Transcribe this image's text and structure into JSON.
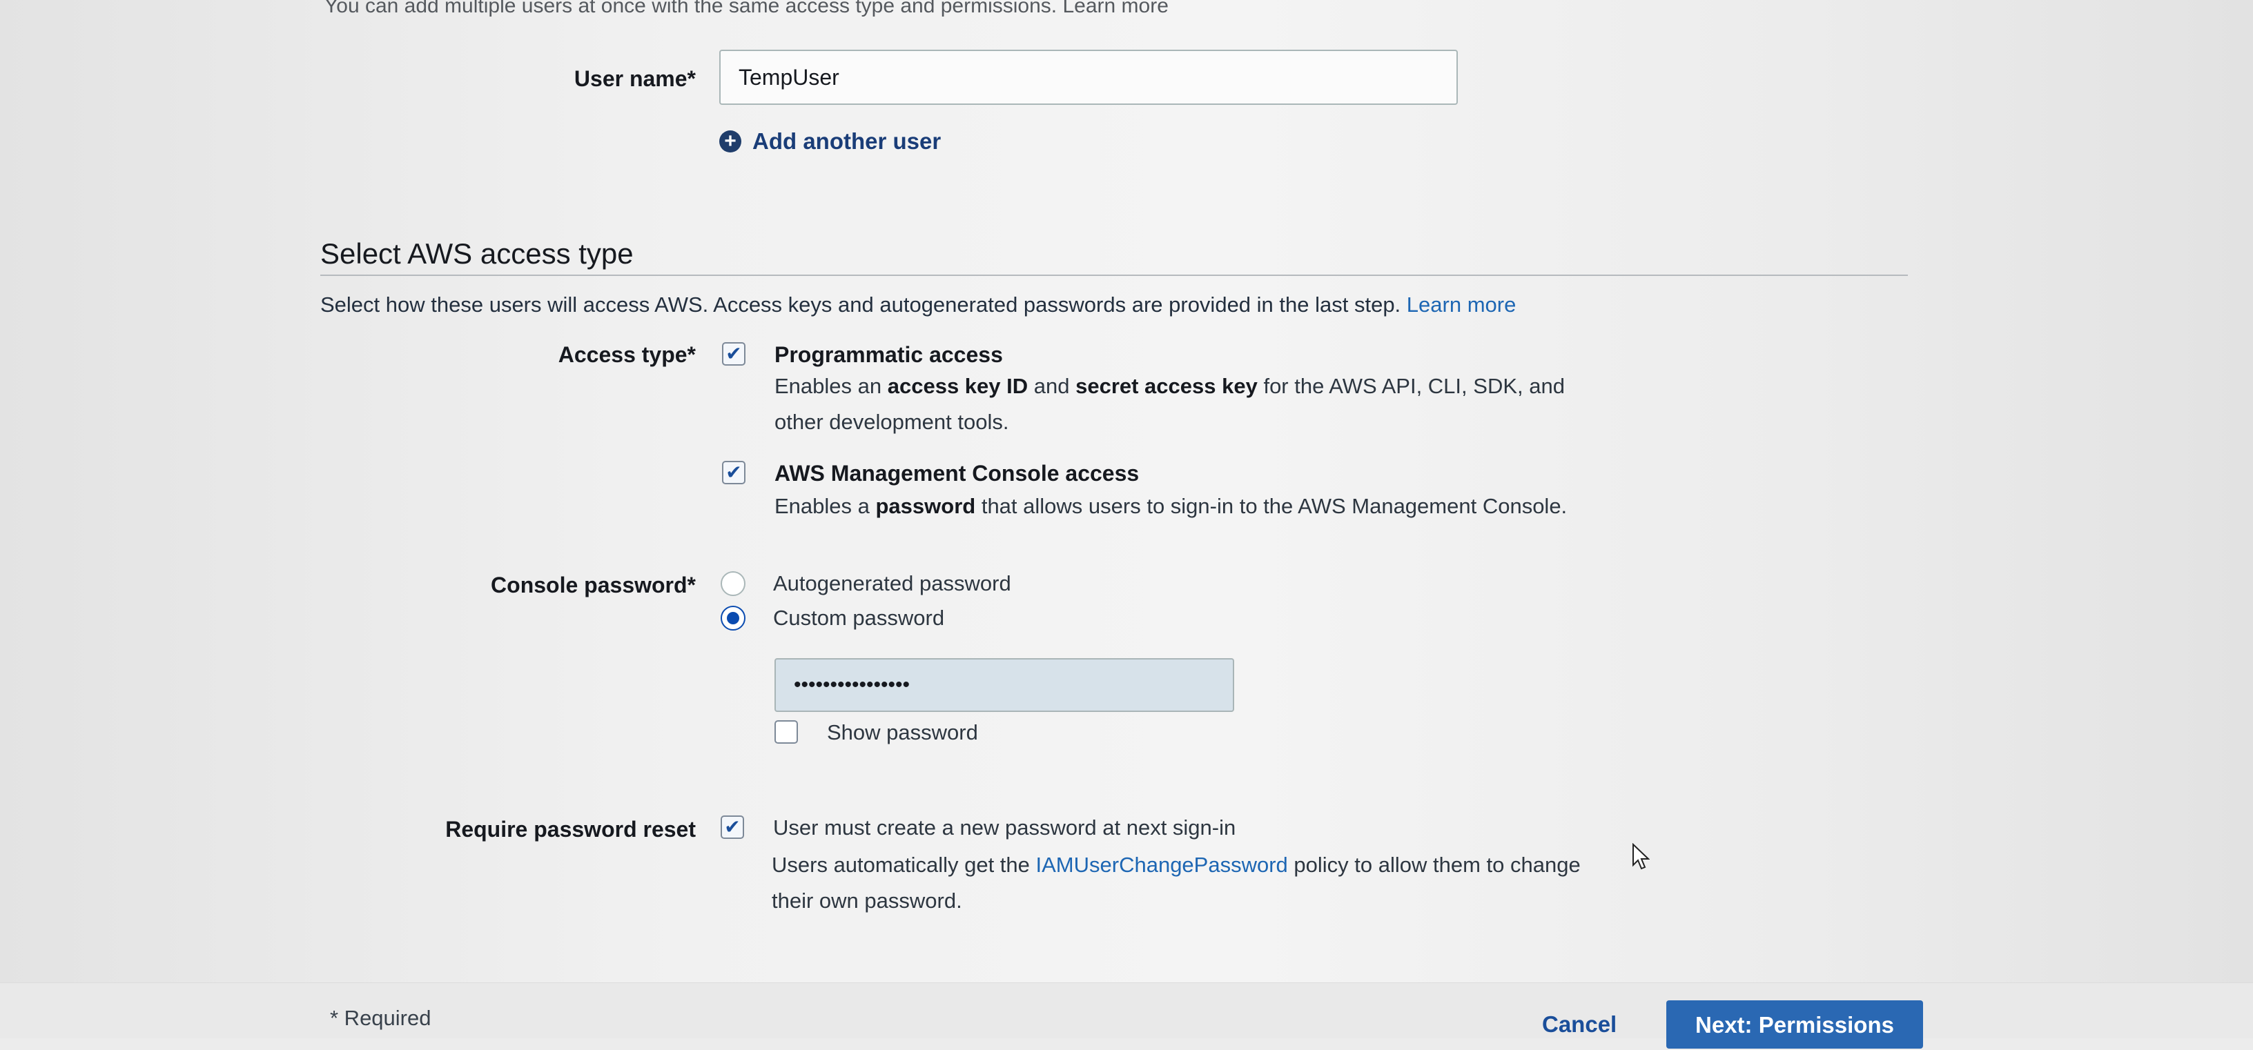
{
  "top_cut_text": "You can add multiple users at once with the same access type and permissions. Learn more",
  "user_name": {
    "label": "User name*",
    "value": "TempUser",
    "add_another_label": "Add another user"
  },
  "access_section": {
    "title": "Select AWS access type",
    "description": "Select how these users will access AWS. Access keys and autogenerated passwords are provided in the last step.",
    "learn_more": "Learn more"
  },
  "access_type": {
    "label": "Access type*",
    "options": [
      {
        "title": "Programmatic access",
        "checked": true,
        "desc_1": "Enables an ",
        "desc_b1": "access key ID",
        "desc_2": " and ",
        "desc_b2": "secret access key",
        "desc_3": " for the AWS API, CLI, SDK, and",
        "desc_line2": "other development tools."
      },
      {
        "title": "AWS Management Console access",
        "checked": true,
        "desc_1": "Enables a ",
        "desc_b1": "password",
        "desc_2": " that allows users to sign-in to the AWS Management Console."
      }
    ]
  },
  "console_password": {
    "label": "Console password*",
    "options": [
      {
        "label": "Autogenerated password",
        "selected": false
      },
      {
        "label": "Custom password",
        "selected": true
      }
    ],
    "password_value": "••••••••••••••••",
    "show_password_label": "Show password",
    "show_password_checked": false
  },
  "password_reset": {
    "label": "Require password reset",
    "checked": true,
    "title": "User must create a new password at next sign-in",
    "desc_1": "Users automatically get the ",
    "desc_link": "IAMUserChangePassword",
    "desc_2": " policy to allow them to change",
    "desc_line2": "their own password."
  },
  "footer": {
    "required_note": "* Required",
    "cancel_label": "Cancel",
    "next_label": "Next: Permissions"
  },
  "colors": {
    "accent": "#0a4bb0",
    "link": "#1d66b3",
    "primary_button": "#2a68b3"
  }
}
